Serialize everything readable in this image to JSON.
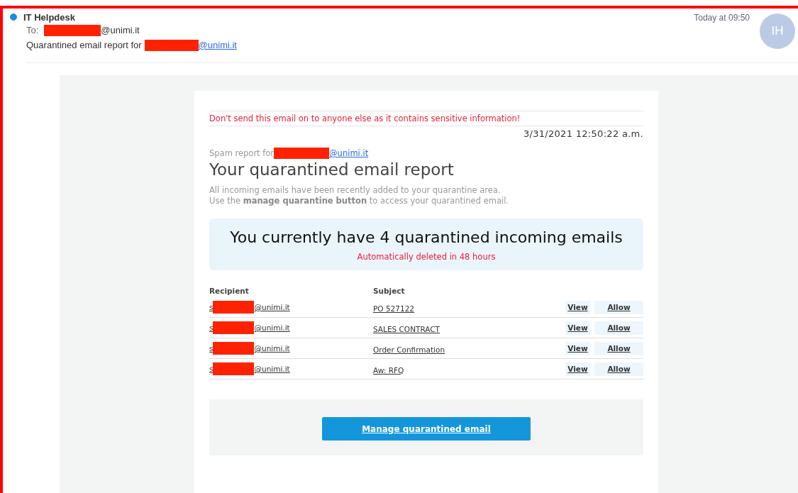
{
  "message": {
    "sender": "IT Helpdesk",
    "unread": true,
    "to_label": "To:",
    "to_suffix": "@unimi.it",
    "subject": "Quarantined email report for",
    "subject_link": "@unimi.it",
    "time": "Today at 09:50",
    "avatar": "IH"
  },
  "report": {
    "warning": "Don't send this email on to anyone else as it contains sensitive information!",
    "timestamp": "3/31/2021 12:50:22 a.m.",
    "spam_for": "Spam report for",
    "spam_link": "@unimi.it",
    "title": "Your quarantined email report",
    "intro": [
      "All incoming emails have been recently added to your quarantine area.",
      "Use the **manage quarantine button** to access your quarantined email."
    ],
    "summary": "You currently have 4 quarantined incoming emails",
    "summary_note": "Automatically deleted in 48 hours",
    "columns": [
      "Recipient",
      "Subject"
    ],
    "rows": [
      {
        "recipient_prefix": "s",
        "recipient_suffix": "@unimi.it",
        "subject": "PO 527122",
        "view": "View",
        "allow": "Allow"
      },
      {
        "recipient_prefix": "s",
        "recipient_suffix": "@unimi.it",
        "subject": "SALES CONTRACT",
        "view": "View",
        "allow": "Allow"
      },
      {
        "recipient_prefix": "s",
        "recipient_suffix": "@unimi.it",
        "subject": "Order Confirmation",
        "view": "View",
        "allow": "Allow"
      },
      {
        "recipient_prefix": "s",
        "recipient_suffix": "@unimi.it",
        "subject": "Aw: RFQ",
        "view": "View",
        "allow": "Allow"
      }
    ],
    "button": "Manage quarantined email"
  }
}
